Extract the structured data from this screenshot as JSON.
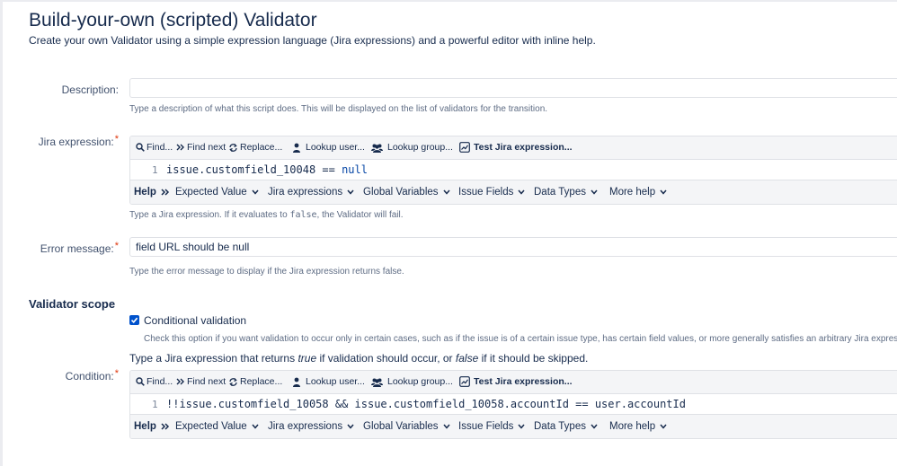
{
  "header": {
    "title": "Build-your-own (scripted) Validator",
    "subtitle": "Create your own Validator using a simple expression language (Jira expressions) and a powerful editor with inline help."
  },
  "description": {
    "label": "Description:",
    "value": "",
    "hint": "Type a description of what this script does. This will be displayed on the list of validators for the transition."
  },
  "toolbar": {
    "find": "Find...",
    "find_next": "Find next",
    "replace": "Replace...",
    "lookup_user": "Lookup user...",
    "lookup_group": "Lookup group...",
    "test": "Test Jira expression..."
  },
  "help_bar": {
    "help": "Help",
    "items": [
      "Expected Value",
      "Jira expressions",
      "Global Variables",
      "Issue Fields",
      "Data Types",
      "More help"
    ]
  },
  "jira_expression": {
    "label": "Jira expression:",
    "required_mark": "*",
    "line_number": "1",
    "code_prefix": "issue.customfield_10048 == ",
    "code_keyword": "null",
    "hint_before": "Type a Jira expression. If it evaluates to ",
    "hint_code": "false",
    "hint_after": ", the Validator will fail."
  },
  "error_message": {
    "label": "Error message:",
    "required_mark": "*",
    "value": "field URL should be null",
    "hint": "Type the error message to display if the Jira expression returns false."
  },
  "validator_scope": {
    "title": "Validator scope",
    "checkbox_label": "Conditional validation",
    "checked": true,
    "checkbox_hint": "Check this option if you want validation to occur only in certain cases, such as if the issue is of a certain issue type, has certain field values, or more generally satisfies an arbitrary Jira expressi",
    "intro_1": "Type a Jira expression that returns ",
    "intro_true": "true",
    "intro_2": " if validation should occur, or ",
    "intro_false": "false",
    "intro_3": " if it should be skipped."
  },
  "condition": {
    "label": "Condition:",
    "required_mark": "*",
    "line_number": "1",
    "code": "!!issue.customfield_10058 && issue.customfield_10058.accountId == user.accountId"
  },
  "colors": {
    "accent": "#0052cc",
    "required": "#de350b",
    "border": "#dfe1e6",
    "toolbar_bg": "#f4f5f7"
  }
}
